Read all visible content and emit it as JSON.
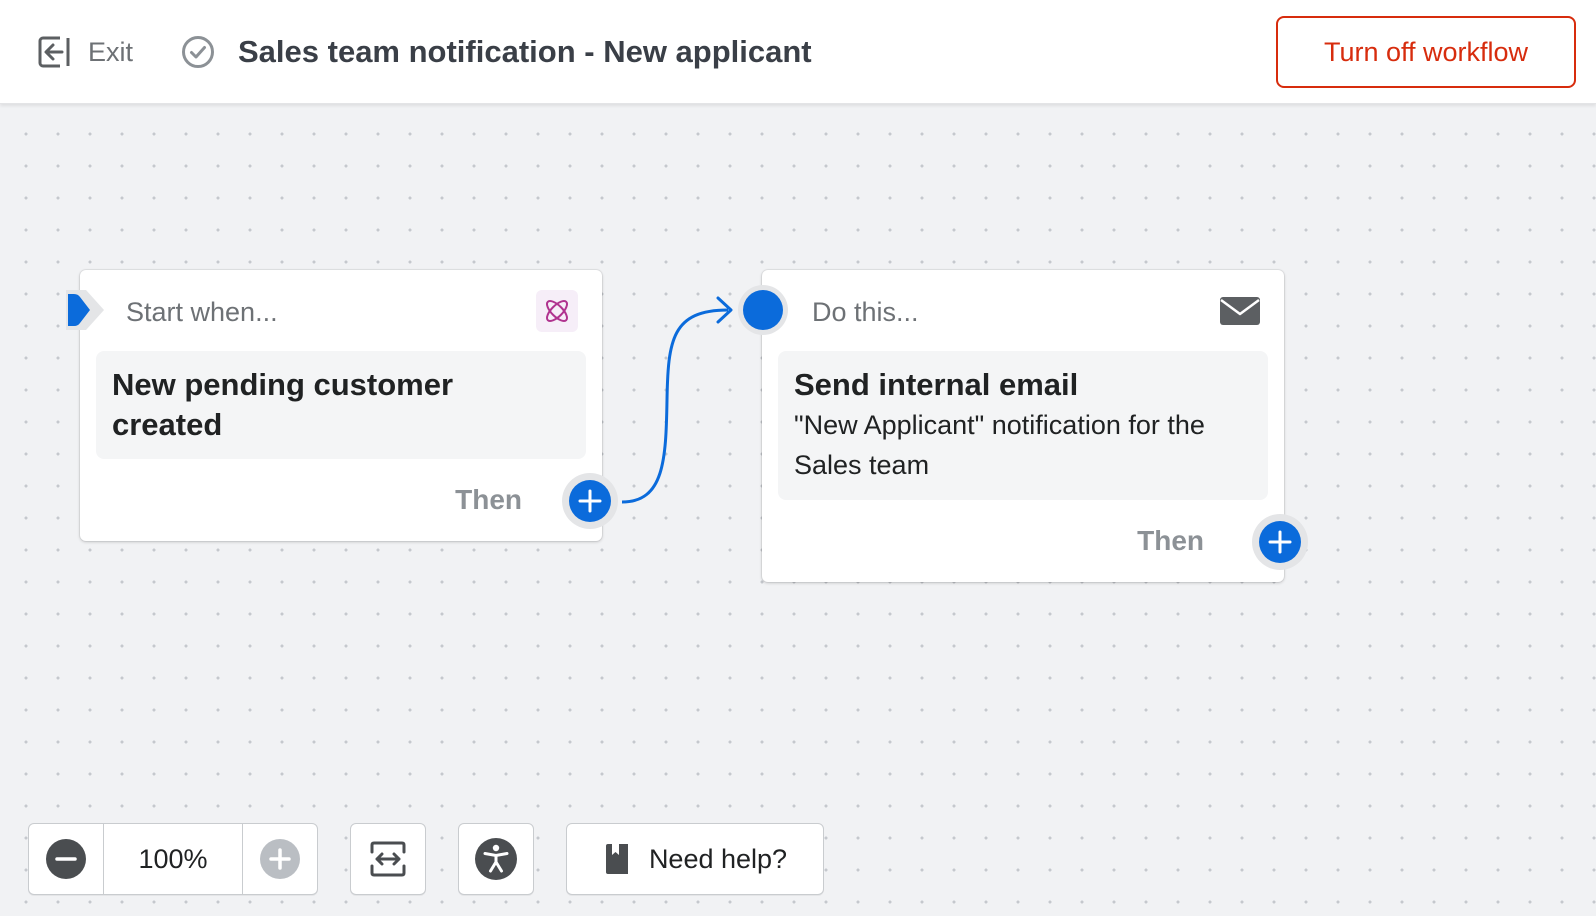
{
  "header": {
    "exit_label": "Exit",
    "exit_icon": "exit-icon",
    "status_icon": "check-circle-icon",
    "title": "Sales team notification - New applicant",
    "turn_off_label": "Turn off workflow"
  },
  "trigger": {
    "header": "Start when...",
    "app_icon": "flow-app-icon",
    "title": "New pending customer created",
    "then_label": "Then"
  },
  "action": {
    "header": "Do this...",
    "app_icon": "mail-icon",
    "title": "Send internal email",
    "description": "\"New Applicant\" notification for the Sales team",
    "then_label": "Then"
  },
  "controls": {
    "zoom_value": "100%",
    "help_label": "Need help?"
  },
  "colors": {
    "accent": "#0b6bdb",
    "critical": "#d72c0d",
    "canvas": "#f1f2f4"
  }
}
